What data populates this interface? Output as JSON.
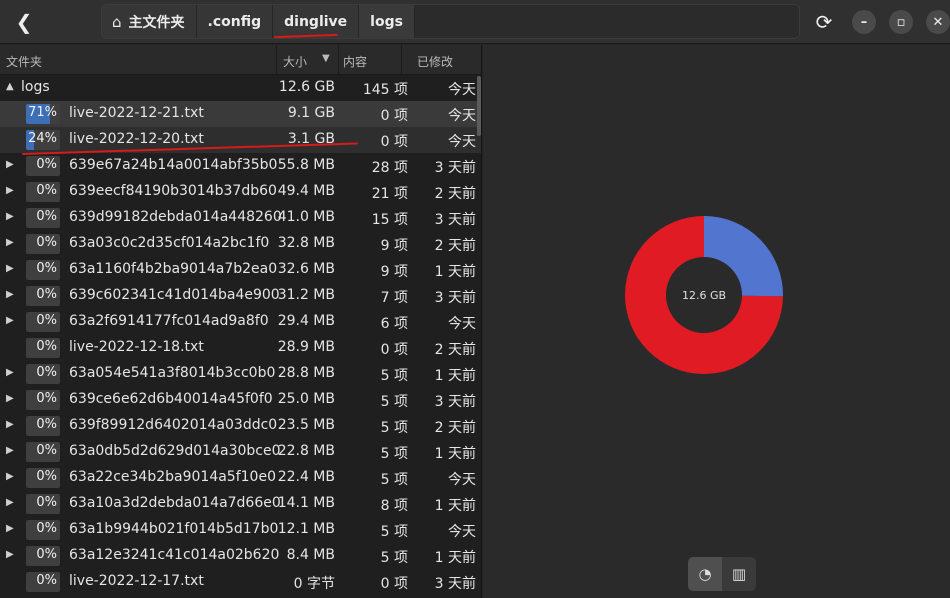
{
  "header": {
    "back_icon": "back-arrow-icon",
    "breadcrumbs": [
      "主文件夹",
      ".config",
      "dinglive",
      "logs"
    ],
    "home_icon": "home-icon",
    "refresh_icon": "refresh-icon",
    "window_controls": [
      "minimize-icon",
      "maximize-icon",
      "close-icon"
    ]
  },
  "columns": {
    "folder": "文件夹",
    "size": "大小",
    "contents": "内容",
    "modified": "已修改"
  },
  "root": {
    "name": "logs",
    "size": "12.6 GB",
    "contents": "145 项",
    "modified": "今天"
  },
  "rows": [
    {
      "expandable": false,
      "percent": 71,
      "pct_label": "71%",
      "name": "live-2022-12-21.txt",
      "size": "9.1 GB",
      "contents": "0 项",
      "modified": "今天"
    },
    {
      "expandable": false,
      "percent": 24,
      "pct_label": "24%",
      "name": "live-2022-12-20.txt",
      "size": "3.1 GB",
      "contents": "0 项",
      "modified": "今天"
    },
    {
      "expandable": true,
      "percent": 0,
      "pct_label": "0%",
      "name": "639e67a24b14a0014abf35b0",
      "size": "55.8 MB",
      "contents": "28 项",
      "modified": "3 天前"
    },
    {
      "expandable": true,
      "percent": 0,
      "pct_label": "0%",
      "name": "639eecf84190b3014b37db60",
      "size": "49.4 MB",
      "contents": "21 项",
      "modified": "2 天前"
    },
    {
      "expandable": true,
      "percent": 0,
      "pct_label": "0%",
      "name": "639d99182debda014a448260",
      "size": "41.0 MB",
      "contents": "15 项",
      "modified": "3 天前"
    },
    {
      "expandable": true,
      "percent": 0,
      "pct_label": "0%",
      "name": "63a03c0c2d35cf014a2bc1f0",
      "size": "32.8 MB",
      "contents": "9 项",
      "modified": "2 天前"
    },
    {
      "expandable": true,
      "percent": 0,
      "pct_label": "0%",
      "name": "63a1160f4b2ba9014a7b2ea0",
      "size": "32.6 MB",
      "contents": "9 项",
      "modified": "1 天前"
    },
    {
      "expandable": true,
      "percent": 0,
      "pct_label": "0%",
      "name": "639c602341c41d014ba4e900",
      "size": "31.2 MB",
      "contents": "7 项",
      "modified": "3 天前"
    },
    {
      "expandable": true,
      "percent": 0,
      "pct_label": "0%",
      "name": "63a2f6914177fc014ad9a8f0",
      "size": "29.4 MB",
      "contents": "6 项",
      "modified": "今天"
    },
    {
      "expandable": false,
      "percent": 0,
      "pct_label": "0%",
      "name": "live-2022-12-18.txt",
      "size": "28.9 MB",
      "contents": "0 项",
      "modified": "2 天前"
    },
    {
      "expandable": true,
      "percent": 0,
      "pct_label": "0%",
      "name": "63a054e541a3f8014b3cc0b0",
      "size": "28.8 MB",
      "contents": "5 项",
      "modified": "1 天前"
    },
    {
      "expandable": true,
      "percent": 0,
      "pct_label": "0%",
      "name": "639ce6e62d6b40014a45f0f0",
      "size": "25.0 MB",
      "contents": "5 项",
      "modified": "3 天前"
    },
    {
      "expandable": true,
      "percent": 0,
      "pct_label": "0%",
      "name": "639f89912d6402014a03ddc0",
      "size": "23.5 MB",
      "contents": "5 项",
      "modified": "2 天前"
    },
    {
      "expandable": true,
      "percent": 0,
      "pct_label": "0%",
      "name": "63a0db5d2d629d014a30bce0",
      "size": "22.8 MB",
      "contents": "5 项",
      "modified": "1 天前"
    },
    {
      "expandable": true,
      "percent": 0,
      "pct_label": "0%",
      "name": "63a22ce34b2ba9014a5f10e0",
      "size": "22.4 MB",
      "contents": "5 项",
      "modified": "今天"
    },
    {
      "expandable": true,
      "percent": 0,
      "pct_label": "0%",
      "name": "63a10a3d2debda014a7d66e0",
      "size": "14.1 MB",
      "contents": "8 项",
      "modified": "1 天前"
    },
    {
      "expandable": true,
      "percent": 0,
      "pct_label": "0%",
      "name": "63a1b9944b021f014b5d17b0",
      "size": "12.1 MB",
      "contents": "5 项",
      "modified": "今天"
    },
    {
      "expandable": true,
      "percent": 0,
      "pct_label": "0%",
      "name": "63a12e3241c41c014a02b620",
      "size": "8.4 MB",
      "contents": "5 项",
      "modified": "1 天前"
    },
    {
      "expandable": false,
      "percent": 0,
      "pct_label": "0%",
      "name": "live-2022-12-17.txt",
      "size": "0 字节",
      "contents": "0 项",
      "modified": "3 天前"
    }
  ],
  "chart_data": {
    "type": "pie",
    "center_label": "12.6 GB",
    "categories": [
      "live-2022-12-21.txt",
      "live-2022-12-20.txt"
    ],
    "values": [
      71,
      24
    ],
    "colors": [
      "#e01b24",
      "#5276d0"
    ]
  },
  "view_toggle": {
    "ring_chart_icon": "ring-chart-icon",
    "treemap_icon": "treemap-icon"
  },
  "annotation_color": "#d71a1a"
}
